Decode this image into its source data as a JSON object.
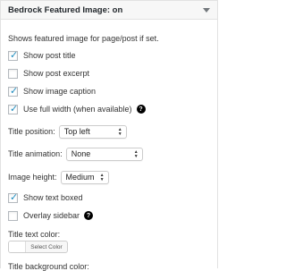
{
  "header": {
    "title": "Bedrock Featured Image: on"
  },
  "description": "Shows featured image for page/post if set.",
  "options": {
    "show_post_title": {
      "label": "Show post title",
      "checked": true
    },
    "show_post_excerpt": {
      "label": "Show post excerpt",
      "checked": false
    },
    "show_image_caption": {
      "label": "Show image caption",
      "checked": true
    },
    "use_full_width": {
      "label": "Use full width (when available)",
      "checked": true,
      "help": "?"
    },
    "show_text_boxed": {
      "label": "Show text boxed",
      "checked": true
    },
    "overlay_sidebar": {
      "label": "Overlay sidebar",
      "checked": false,
      "help": "?"
    }
  },
  "fields": {
    "title_position": {
      "label": "Title position:",
      "value": "Top left"
    },
    "title_animation": {
      "label": "Title animation:",
      "value": "None"
    },
    "image_height": {
      "label": "Image height:",
      "value": "Medium"
    }
  },
  "title_text_color": {
    "label": "Title text color:",
    "button": "Select Color",
    "swatch": "#ffffff"
  },
  "next_label_partial": "Title background color:",
  "colors": {
    "accent": "#1e8cbe",
    "header_bg": "#f7f7f7",
    "border": "#e2e2e2"
  }
}
